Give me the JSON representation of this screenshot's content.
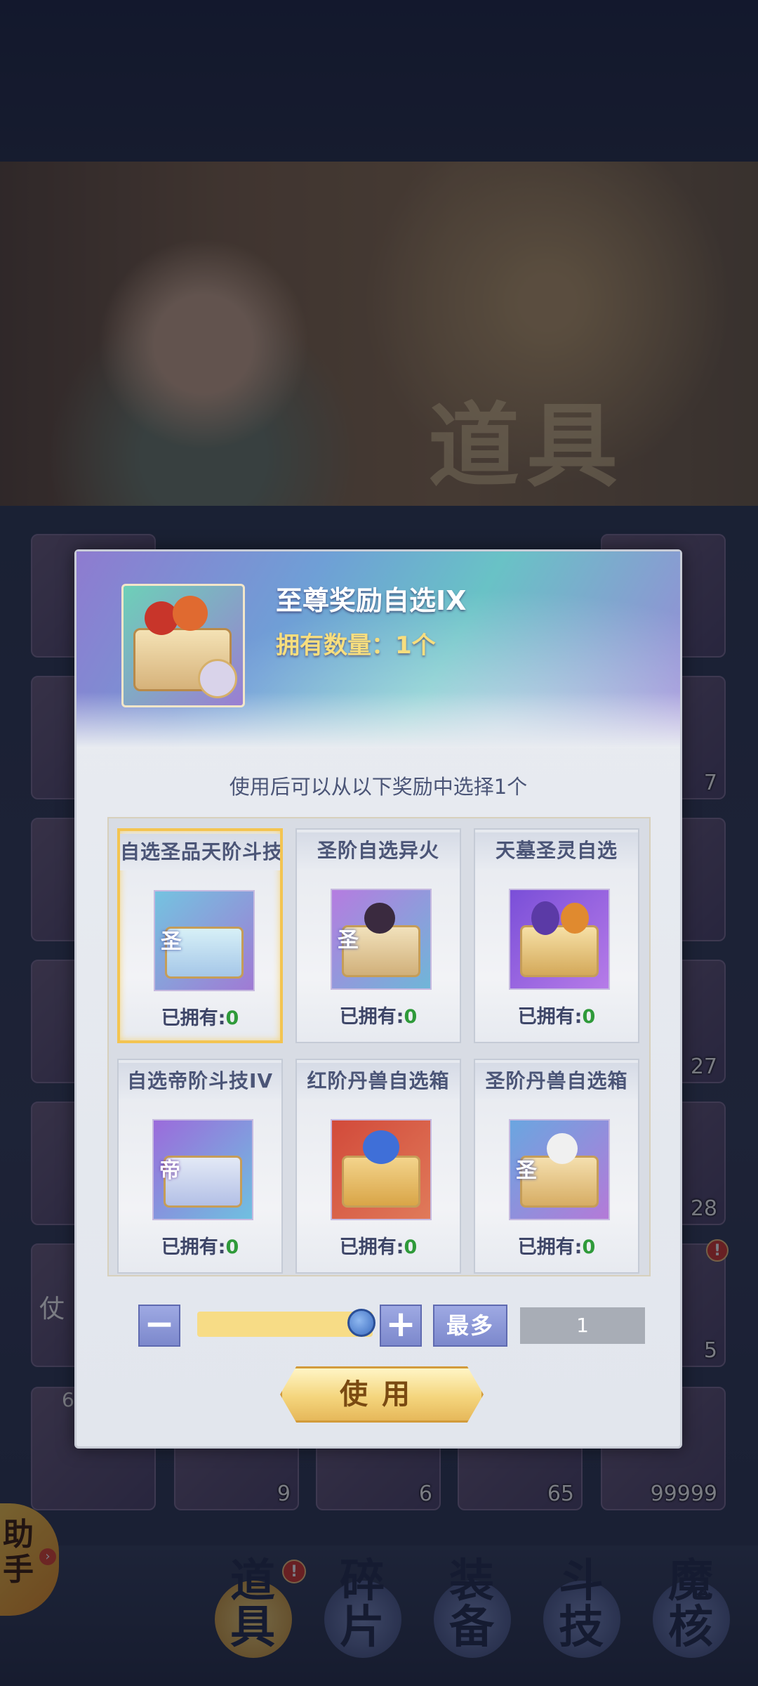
{
  "banner": {
    "title": "道具"
  },
  "bag": {
    "counts": [
      "7",
      "27",
      "28",
      "5",
      "9",
      "6",
      "65",
      "99999",
      "6"
    ],
    "partial_label": "仗"
  },
  "assistant": {
    "label": "助手"
  },
  "tabs": [
    {
      "label": "道具",
      "badge": "!"
    },
    {
      "label": "碎片"
    },
    {
      "label": "装备"
    },
    {
      "label": "斗技"
    },
    {
      "label": "魔核"
    }
  ],
  "modal": {
    "item_name": "至尊奖励自选IX",
    "item_quantity": "拥有数量：1个",
    "instruction": "使用后可以从以下奖励中选择1个",
    "rewards": [
      {
        "title": "自选圣品天阶斗技",
        "owned_label": "已拥有:",
        "owned": "0",
        "badge": "圣"
      },
      {
        "title": "圣阶自选异火",
        "owned_label": "已拥有:",
        "owned": "0",
        "badge": "圣"
      },
      {
        "title": "天墓圣灵自选",
        "owned_label": "已拥有:",
        "owned": "0",
        "badge": ""
      },
      {
        "title": "自选帝阶斗技IV",
        "owned_label": "已拥有:",
        "owned": "0",
        "badge": "帝"
      },
      {
        "title": "红阶丹兽自选箱",
        "owned_label": "已拥有:",
        "owned": "0",
        "badge": ""
      },
      {
        "title": "圣阶丹兽自选箱",
        "owned_label": "已拥有:",
        "owned": "0",
        "badge": "圣"
      }
    ],
    "minus_label": "−",
    "plus_label": "+",
    "max_label": "最多",
    "quantity_value": "1",
    "slider_level": 1.0,
    "use_label": "使用"
  },
  "colors": {
    "owned_number": "#2f9a3a",
    "selected_border": "#f3c451",
    "quantity_text": "#f7de7e"
  }
}
